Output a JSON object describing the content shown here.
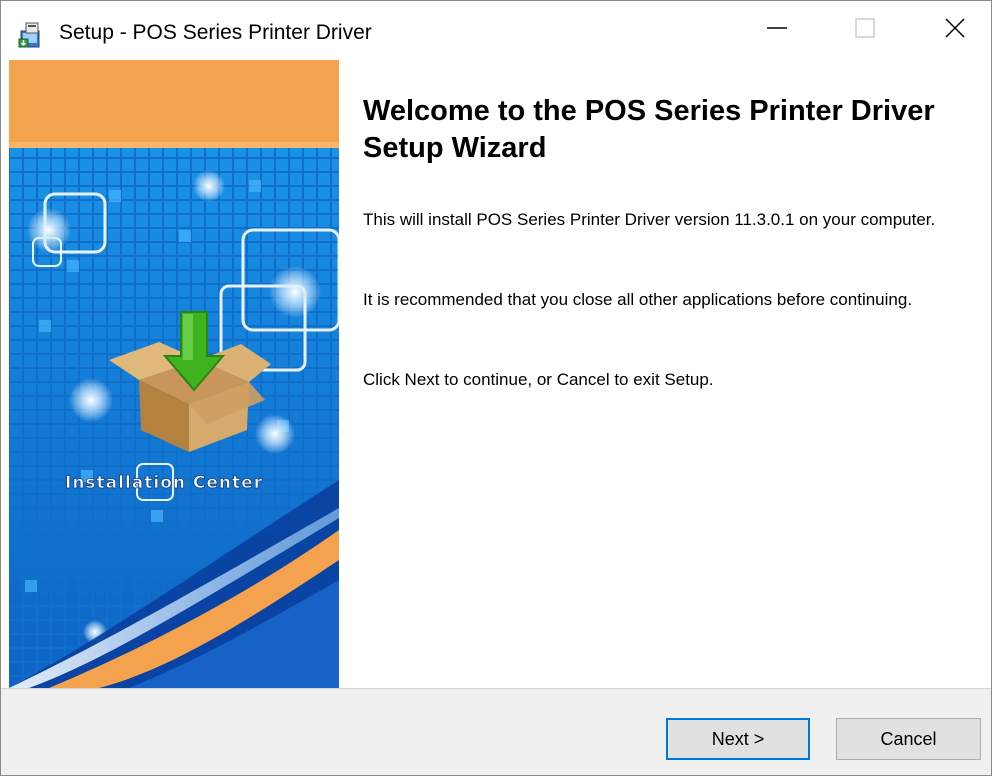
{
  "window": {
    "title": "Setup - POS Series Printer Driver",
    "controls": {
      "minimize": "minimize-icon",
      "maximize": "maximize-icon",
      "close": "close-icon"
    }
  },
  "banner": {
    "caption": "Installation Center",
    "colors": {
      "orange": "#f4a24e",
      "blue": "#1d8ee0",
      "deep_blue": "#0d4fa8"
    }
  },
  "content": {
    "heading": "Welcome to the POS Series Printer Driver Setup Wizard",
    "paragraphs": [
      "This will install POS Series Printer Driver version 11.3.0.1 on your computer.",
      "It is recommended that you close all other applications before continuing.",
      "Click Next to continue, or Cancel to exit Setup."
    ]
  },
  "footer": {
    "next_label": "Next >",
    "cancel_label": "Cancel",
    "accent": "#0078d7"
  }
}
